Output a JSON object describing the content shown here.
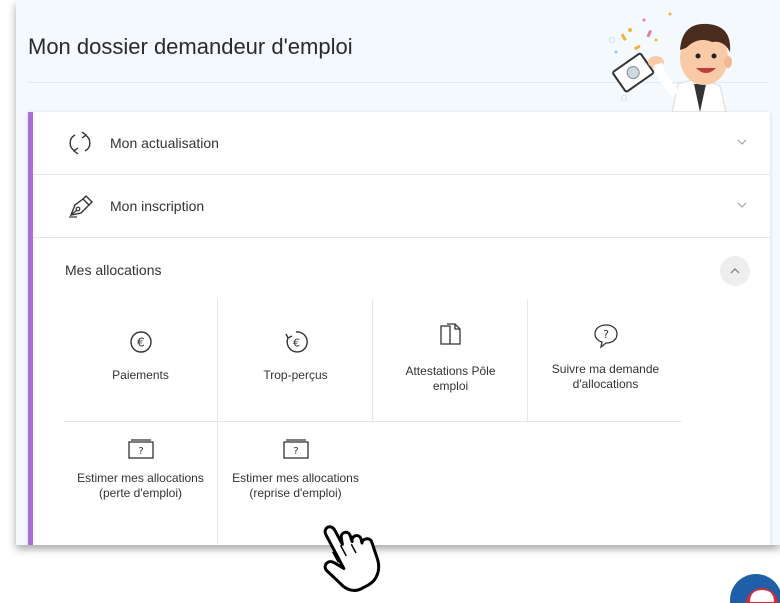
{
  "page": {
    "title": "Mon dossier demandeur d'emploi"
  },
  "sections": [
    {
      "label": "Mon actualisation",
      "icon": "refresh-icon",
      "state": "collapsed"
    },
    {
      "label": "Mon inscription",
      "icon": "pen-icon",
      "state": "collapsed"
    }
  ],
  "allocations": {
    "title": "Mes allocations",
    "state": "expanded",
    "tiles": [
      {
        "label": "Paiements",
        "icon": "euro-icon"
      },
      {
        "label": "Trop-perçus",
        "icon": "euro-refund-icon"
      },
      {
        "label": "Attestations Pôle emploi",
        "icon": "documents-icon"
      },
      {
        "label": "Suivre ma demande d'allocations",
        "icon": "question-bubble-icon"
      },
      {
        "label": "Estimer mes allocations (perte d'emploi)",
        "icon": "simulator-icon"
      },
      {
        "label": "Estimer mes allocations (reprise d'emploi)",
        "icon": "simulator-icon"
      }
    ]
  },
  "colors": {
    "accent": "#a86ee0",
    "background": "#f3f9fd",
    "brand_blue": "#1d5fa8",
    "brand_red": "#e3262b"
  }
}
